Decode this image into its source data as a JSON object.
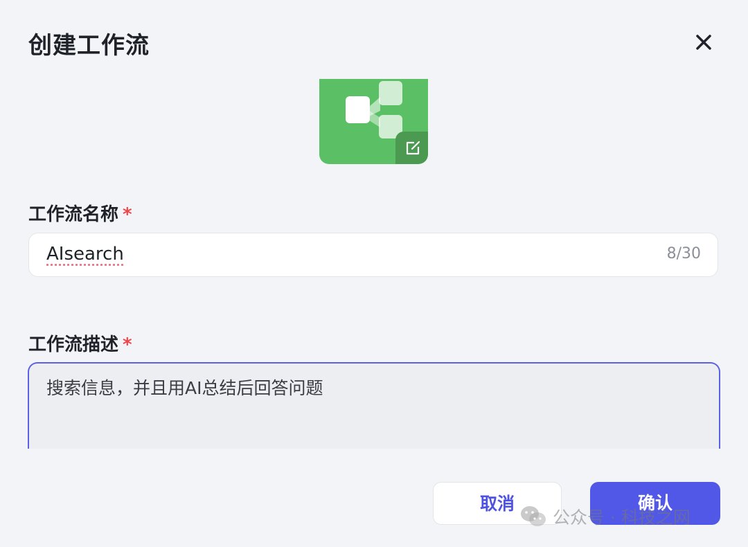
{
  "dialog": {
    "title": "创建工作流",
    "close_icon": "close-icon"
  },
  "workflow_icon": {
    "icon": "workflow-branch-icon",
    "edit_icon": "edit-icon",
    "background_color": "#5bc065"
  },
  "name_field": {
    "label": "工作流名称",
    "required_mark": "*",
    "value": "AIsearch",
    "counter": "8/30"
  },
  "description_field": {
    "label": "工作流描述",
    "required_mark": "*",
    "value": "搜索信息，并且用AI总结后回答问题"
  },
  "actions": {
    "cancel_label": "取消",
    "confirm_label": "确认",
    "accent_color": "#5157e6"
  },
  "watermark": {
    "text": "公众号 · 科技之网",
    "icon": "wechat-icon"
  }
}
